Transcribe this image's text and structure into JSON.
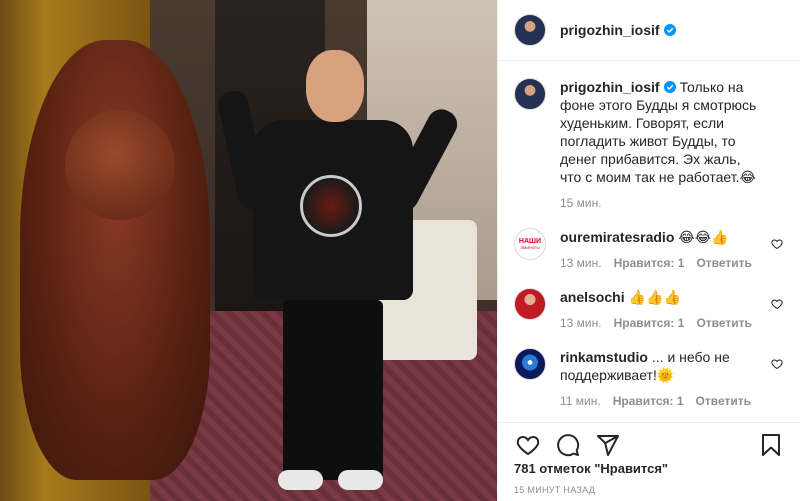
{
  "post": {
    "author": "prigozhin_iosif",
    "verified": true,
    "photo_alt": "Photo by prigozhin_iosif"
  },
  "caption": {
    "username": "prigozhin_iosif",
    "text": "Только на фоне этого Будды я смотрюсь худеньким. Говорят, если погладить живот Будды, то денег прибавится. Эх жаль, что с моим так не работает.😂",
    "time": "15 мин."
  },
  "comments": [
    {
      "username": "ouremiratesradio",
      "text": "😂😂👍",
      "time": "13 мин.",
      "likes": "Нравится: 1",
      "reply": "Ответить",
      "avatar_text1": "НАШИ",
      "avatar_text2": "ЭМИРАТЫ"
    },
    {
      "username": "anelsochi",
      "text": "👍👍👍",
      "time": "13 мин.",
      "likes": "Нравится: 1",
      "reply": "Ответить"
    },
    {
      "username": "rinkamstudio",
      "text": "... и небо не поддерживает!🌞",
      "time": "11 мин.",
      "likes": "Нравится: 1",
      "reply": "Ответить"
    }
  ],
  "footer": {
    "likes_text": "781 отметок \"Нравится\"",
    "time_ago": "15 МИНУТ НАЗАД"
  },
  "icons": {
    "like": "heart-icon",
    "comment": "comment-icon",
    "share": "share-icon",
    "save": "bookmark-icon",
    "verified": "verified-badge-icon"
  },
  "colors": {
    "verified": "#0095f6",
    "meta": "#8e8e8e",
    "text": "#262626"
  }
}
